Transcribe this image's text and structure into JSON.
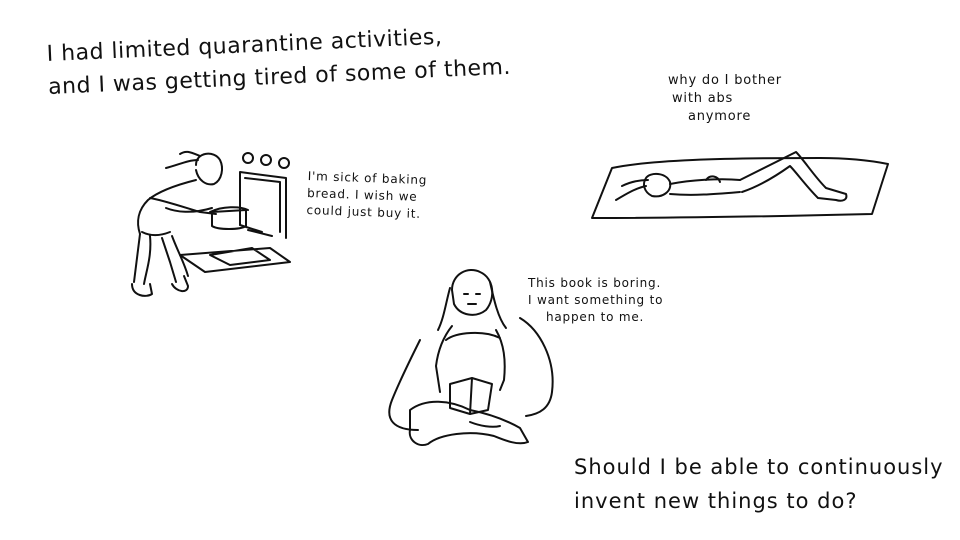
{
  "title_lines": [
    "I had limited quarantine activities,",
    "and I was getting tired of some of them."
  ],
  "captions": {
    "baking": [
      "I'm sick of baking",
      "bread. I wish we",
      "could just buy it."
    ],
    "abs": [
      "why do I bother",
      "with abs",
      "anymore"
    ],
    "book": [
      "This book is boring.",
      "I want something to",
      "happen to me."
    ]
  },
  "question_lines": [
    "Should I be able to continuously",
    "invent new things to do?"
  ]
}
